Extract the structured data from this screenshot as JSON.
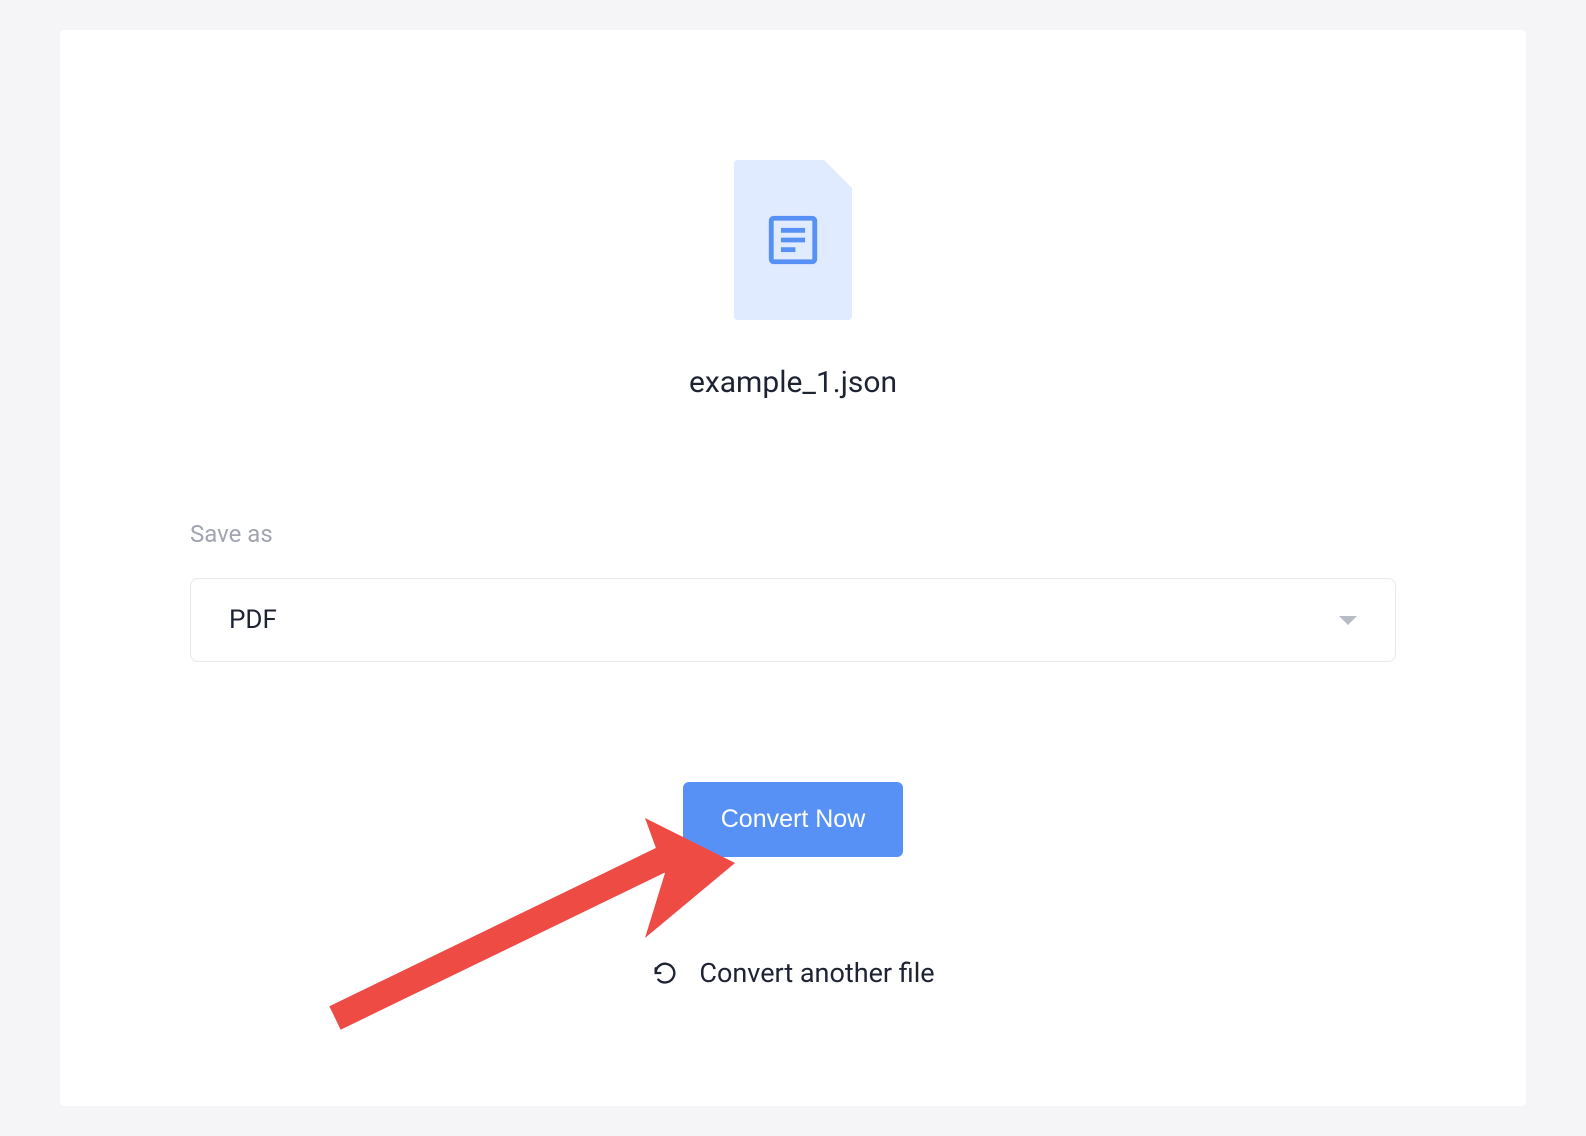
{
  "file": {
    "name": "example_1.json"
  },
  "form": {
    "save_as_label": "Save as",
    "selected_format": "PDF"
  },
  "actions": {
    "convert_label": "Convert Now",
    "convert_another_label": "Convert another file"
  }
}
